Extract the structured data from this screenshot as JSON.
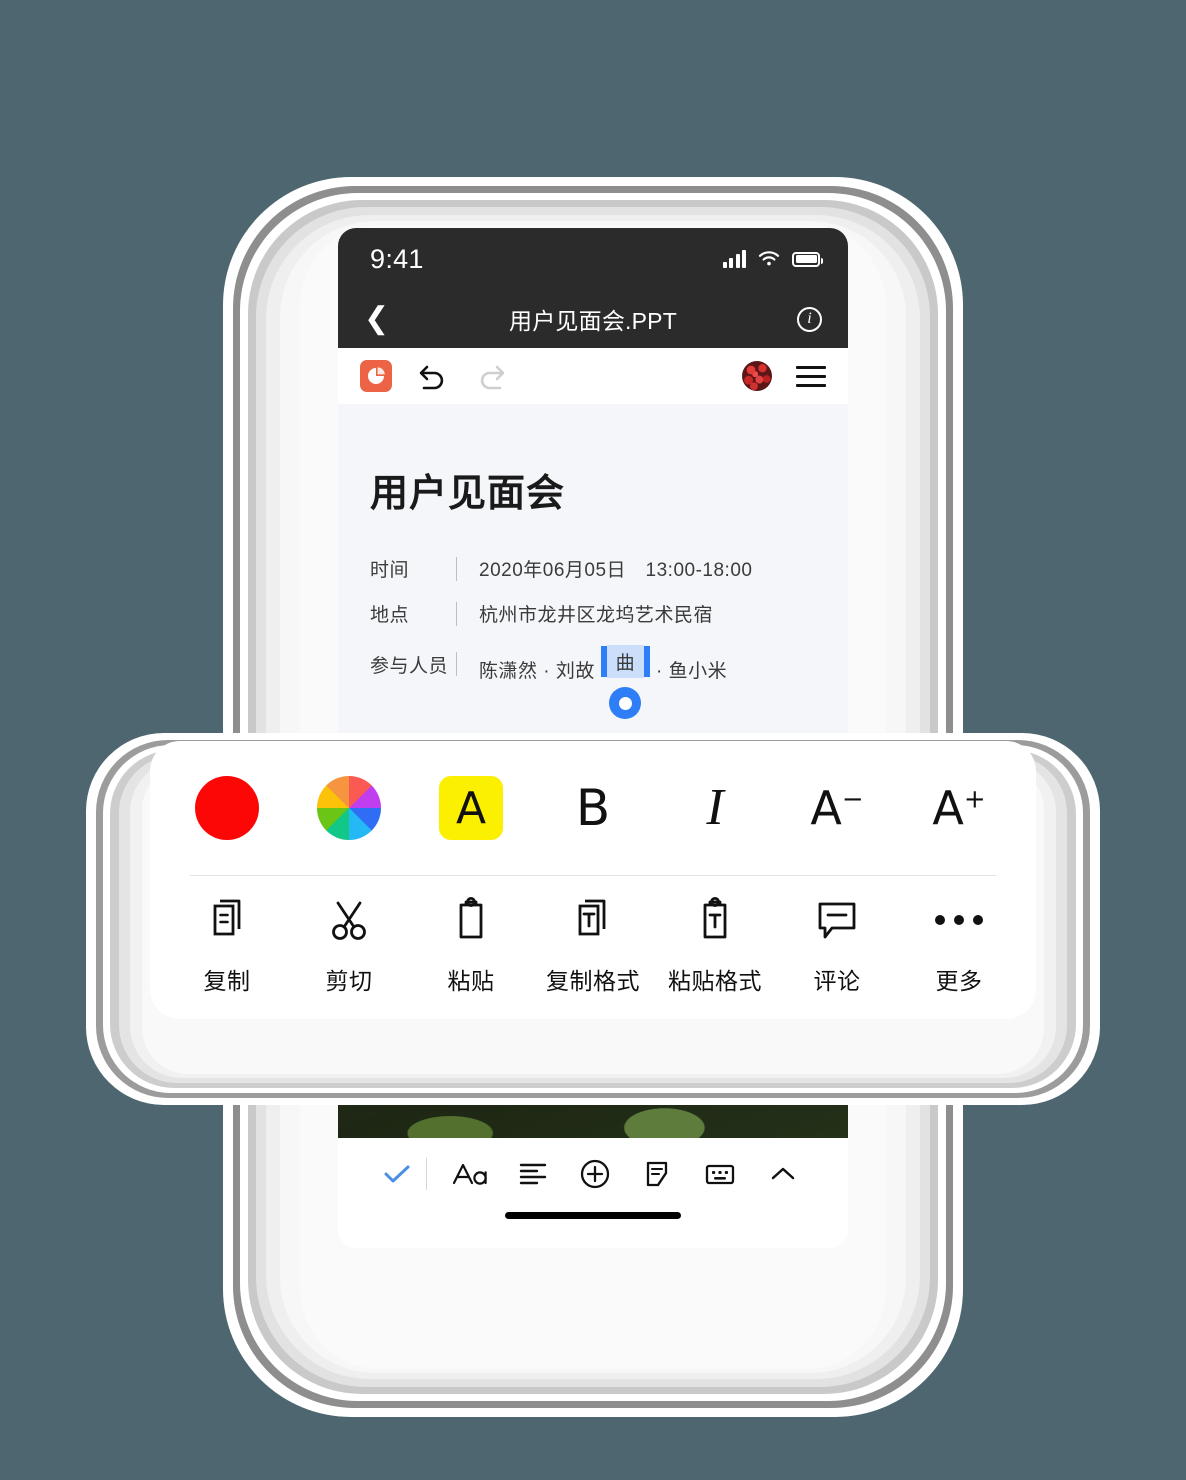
{
  "status_bar": {
    "time": "9:41",
    "signal_icon": "cellular-signal-icon",
    "wifi_icon": "wifi-icon",
    "battery_icon": "battery-icon"
  },
  "nav_bar": {
    "back_icon": "chevron-left-icon",
    "title": "用户见面会.PPT",
    "info_icon": "info-icon",
    "info_glyph": "i"
  },
  "app_toolbar": {
    "app_icon": "ppt-app-icon",
    "undo_label": "撤销",
    "undo_icon": "undo-arrow-icon",
    "redo_label": "重做",
    "redo_icon": "redo-arrow-icon",
    "avatar_icon": "user-avatar",
    "menu_icon": "hamburger-menu-icon"
  },
  "slide": {
    "title": "用户见面会",
    "rows": [
      {
        "label": "时间",
        "value": "2020年06月05日　13:00-18:00"
      },
      {
        "label": "地点",
        "value": "杭州市龙井区龙坞艺术民宿"
      }
    ],
    "attendees": {
      "label": "参与人员",
      "before": "陈潇然 · 刘故",
      "selected": "曲",
      "after": "· 鱼小米"
    },
    "image_alt": "绿色植物叶片照片"
  },
  "context_menu": {
    "format_row": [
      {
        "name": "text-color-swatch",
        "type": "swatch",
        "color": "#fd0606"
      },
      {
        "name": "color-wheel",
        "type": "wheel"
      },
      {
        "name": "highlight-color",
        "type": "highlight",
        "glyph": "A",
        "bg": "#fbf000"
      },
      {
        "name": "bold-button",
        "type": "letter",
        "glyph": "B"
      },
      {
        "name": "italic-button",
        "type": "italic",
        "glyph": "I"
      },
      {
        "name": "decrease-font-size",
        "type": "size",
        "glyph": "A",
        "sup": "−"
      },
      {
        "name": "increase-font-size",
        "type": "size",
        "glyph": "A",
        "sup": "+"
      }
    ],
    "action_row": [
      {
        "name": "copy",
        "label": "复制",
        "icon": "copy-icon"
      },
      {
        "name": "cut",
        "label": "剪切",
        "icon": "scissors-icon"
      },
      {
        "name": "paste",
        "label": "粘贴",
        "icon": "clipboard-icon"
      },
      {
        "name": "copy-format",
        "label": "复制格式",
        "icon": "copy-format-icon"
      },
      {
        "name": "paste-format",
        "label": "粘贴格式",
        "icon": "paste-format-icon"
      },
      {
        "name": "comment",
        "label": "评论",
        "icon": "comment-bubble-icon"
      },
      {
        "name": "more",
        "label": "更多",
        "icon": "ellipsis-icon"
      }
    ]
  },
  "bottom_bar": {
    "items": [
      {
        "name": "confirm",
        "icon": "check-icon",
        "label": "完成"
      },
      {
        "name": "font",
        "icon": "font-aa-icon",
        "label": "字体"
      },
      {
        "name": "align",
        "icon": "align-lines-icon",
        "label": "对齐"
      },
      {
        "name": "insert",
        "icon": "plus-circle-icon",
        "label": "插入"
      },
      {
        "name": "note",
        "icon": "note-edit-icon",
        "label": "备注"
      },
      {
        "name": "keyboard",
        "icon": "keyboard-icon",
        "label": "键盘"
      },
      {
        "name": "collapse",
        "icon": "chevron-up-icon",
        "label": "收起"
      }
    ],
    "home_indicator": "home-indicator"
  },
  "colors": {
    "page_background": "#4d6670",
    "status_bar_bg": "#2b2b2b",
    "slide_bg": "#f4f6fa",
    "accent_blue": "#2d7ef7",
    "selection_bg": "#cbdffb",
    "app_orange": "#ec6345"
  }
}
